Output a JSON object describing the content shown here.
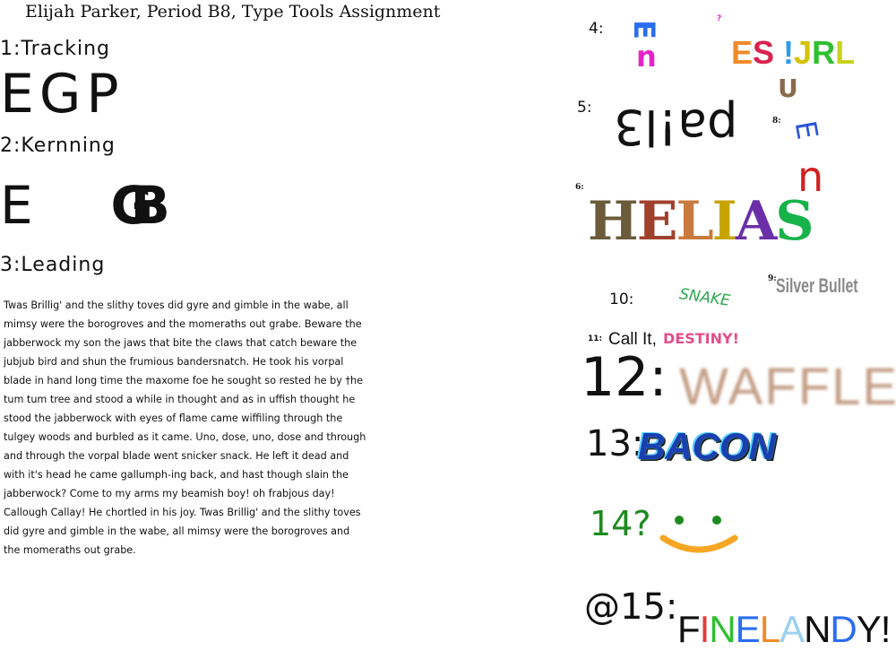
{
  "header": {
    "title": "Elijah Parker, Period B8, Type Tools Assignment"
  },
  "sections": {
    "tracking": {
      "label": "1:Tracking",
      "sample": "EGP"
    },
    "kerning": {
      "label": "2:Kernning",
      "left": "E",
      "mid": "B",
      "back": "G"
    },
    "leading": {
      "label": "3:Leading",
      "text": "Twas Brillig' and the slithy toves did gyre and gimble in the wabe, all mimsy were the borogroves and the momeraths out grabe. Beware the jabberwock my son the jaws that bite the claws that catch beware the jubjub bird and shun the frumious bandersnatch. He took his vorpal blade in hand long time the maxome foe he sought so rested he by †he tum tum tree and stood a while in thought and as in uffish thought he stood the jabberwock with eyes of flame came wiffiling through the tulgey woods and burbled as it came. Uno, dose, uno, dose and through and through the vorpal blade went snicker snack. He left it dead and with it's head he came gallumph-ing back, and hast though slain the jabberwock? Come to my arms my beamish boy! oh frabjous day! Callough Callay! He chortled in his joy. Twas Brillig' and the slithy toves did gyre and gimble in the wabe, all mimsy were the borogroves and the momeraths out grabe."
    }
  },
  "items": {
    "n4": {
      "label": "4:",
      "word": "ESJRL"
    },
    "n5": {
      "label": "5:"
    },
    "n6": {
      "label": "6:",
      "word": "HELIAS"
    },
    "n8": {
      "label": "8:"
    },
    "n9": {
      "label": "9:",
      "word": "Silver Bullet"
    },
    "n10": {
      "label": "10:",
      "word": "SNAKE"
    },
    "n11": {
      "label": "11:",
      "prefix": "Call It,",
      "word": "DESTINY!"
    },
    "n12": {
      "label": "12:",
      "word": "WAFFLE"
    },
    "n13": {
      "label": "13:",
      "word": "BACON"
    },
    "n14": {
      "label": "14?"
    },
    "n15": {
      "label": "@15:",
      "word": "FINELANDY!"
    }
  },
  "colors": {
    "helias": [
      "#6b5b3a",
      "#a0412d",
      "#c97a3e",
      "#c7a400",
      "#6a2fa8",
      "#17b24a",
      "#7a4f9a",
      "#e0a93a"
    ],
    "waffle": "#c49e86",
    "bacon_fill": "#1a3fb0",
    "bacon_glow": "#5fd3ff",
    "smile": "#f6a623",
    "n14": "#1e8a1e",
    "snake": "#2da84f",
    "destiny": "#e44d8c"
  }
}
